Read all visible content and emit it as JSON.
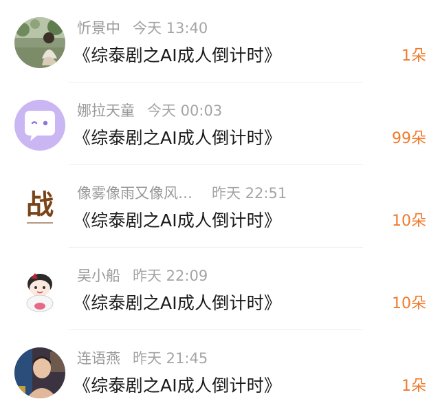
{
  "messages": [
    {
      "name": "忻景中",
      "time": "今天 13:40",
      "title": "《综泰剧之AI成人倒计时》",
      "amount": "1朵",
      "avatar_icon": "photo-avatar-woman-garden"
    },
    {
      "name": "娜拉天童",
      "time": "今天 00:03",
      "title": "《综泰剧之AI成人倒计时》",
      "amount": "99朵",
      "avatar_icon": "chat-bubble-wink-icon"
    },
    {
      "name": "像雾像雨又像风…",
      "time": "昨天 22:51",
      "title": "《综泰剧之AI成人倒计时》",
      "amount": "10朵",
      "avatar_icon": "calligraphy-zhan-icon",
      "avatar_text": "战"
    },
    {
      "name": "吴小船",
      "time": "昨天 22:09",
      "title": "《综泰剧之AI成人倒计时》",
      "amount": "10朵",
      "avatar_icon": "cartoon-character-icon"
    },
    {
      "name": "连语燕",
      "time": "昨天 21:45",
      "title": "《综泰剧之AI成人倒计时》",
      "amount": "1朵",
      "avatar_icon": "photo-avatar-person"
    }
  ],
  "colors": {
    "amount": "#f07a2a",
    "name": "#9a9a9a",
    "title": "#1a1a1a",
    "avatar_bubble_bg": "#c9b6f3"
  }
}
